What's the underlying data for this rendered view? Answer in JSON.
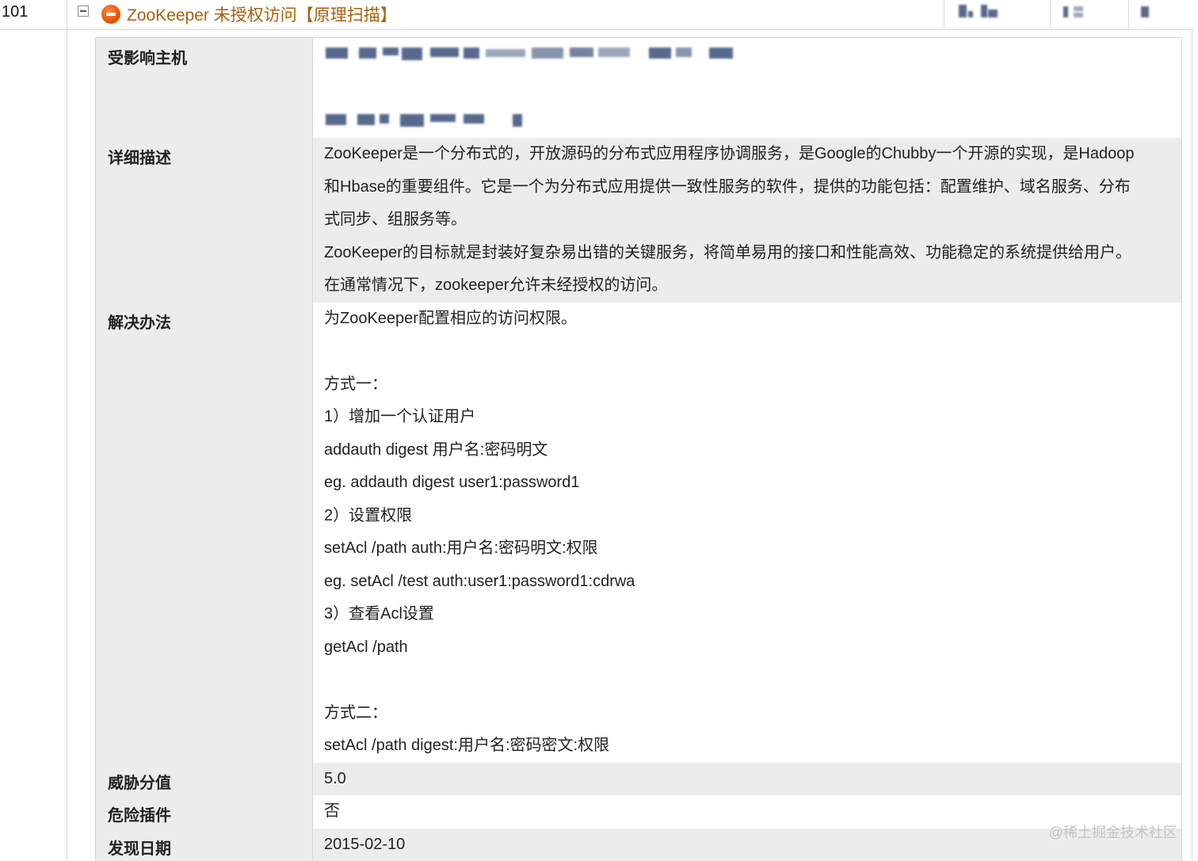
{
  "row_number": "101",
  "vulnerability_title": "ZooKeeper 未授权访问【原理扫描】",
  "details": {
    "affected_hosts_label": "受影响主机",
    "description_label": "详细描述",
    "description_lines": [
      "ZooKeeper是一个分布式的，开放源码的分布式应用程序协调服务，是Google的Chubby一个开源的实现，是Hadoop",
      "和Hbase的重要组件。它是一个为分布式应用提供一致性服务的软件，提供的功能包括：配置维护、域名服务、分布",
      "式同步、组服务等。",
      "ZooKeeper的目标就是封装好复杂易出错的关键服务，将简单易用的接口和性能高效、功能稳定的系统提供给用户。",
      "在通常情况下，zookeeper允许未经授权的访问。"
    ],
    "solution_label": "解决办法",
    "solution_lines": [
      "为ZooKeeper配置相应的访问权限。",
      "",
      "方式一：",
      "1）增加一个认证用户",
      "addauth digest 用户名:密码明文",
      "eg. addauth digest user1:password1",
      "2）设置权限",
      "setAcl /path auth:用户名:密码明文:权限",
      "eg. setAcl /test auth:user1:password1:cdrwa",
      "3）查看Acl设置",
      "getAcl /path",
      "",
      "方式二：",
      "setAcl /path digest:用户名:密码密文:权限"
    ],
    "threat_score_label": "威胁分值",
    "threat_score": "5.0",
    "dangerous_plugin_label": "危险插件",
    "dangerous_plugin": "否",
    "discovery_date_label": "发现日期",
    "discovery_date": "2015-02-10"
  },
  "watermark": "@稀土掘金技术社区",
  "colors": {
    "title": "#a8610e",
    "risk_icon": "#e24b00",
    "label_bg": "#ececec"
  }
}
